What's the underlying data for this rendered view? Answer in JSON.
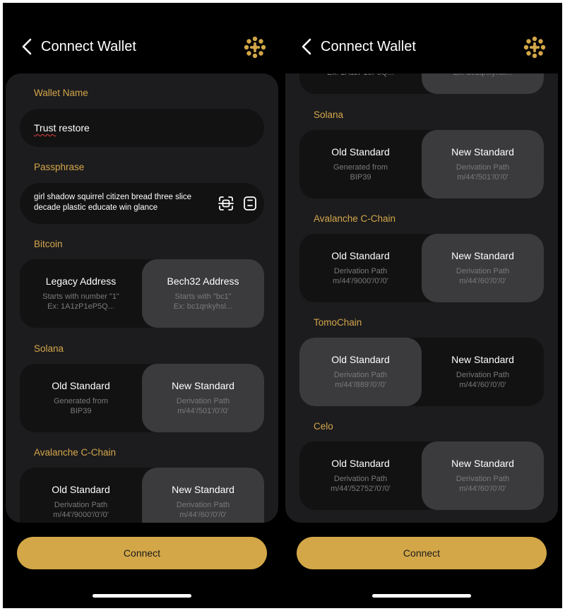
{
  "header": {
    "title": "Connect Wallet"
  },
  "wallet_name": {
    "label": "Wallet Name",
    "value": "Trust restore",
    "value_flagged": "Trust",
    "value_rest": " restore"
  },
  "passphrase": {
    "label": "Passphrase",
    "value": "girl shadow squirrel citizen bread three slice decade plastic educate win glance"
  },
  "bitcoin": {
    "label": "Bitcoin",
    "options": [
      {
        "title": "Legacy Address",
        "desc": "Starts with number \"1\"\nEx: 1A1zP1eP5Q..."
      },
      {
        "title": "Bech32 Address",
        "desc": "Starts with \"bc1\"\nEx: bc1qnkyhsl..."
      }
    ],
    "selected": 1
  },
  "solana": {
    "label": "Solana",
    "options": [
      {
        "title": "Old Standard",
        "desc": "Generated from\nBIP39"
      },
      {
        "title": "New Standard",
        "desc": "Derivation Path\nm/44'/501'/0'/0'"
      }
    ],
    "selected": 1
  },
  "avalanche": {
    "label": "Avalanche C-Chain",
    "options": [
      {
        "title": "Old Standard",
        "desc": "Derivation Path\nm/44'/9000'/0'/0'"
      },
      {
        "title": "New Standard",
        "desc": "Derivation Path\nm/44'/60'/0'/0'"
      }
    ],
    "selected": 1
  },
  "tomochain": {
    "label": "TomoChain",
    "options": [
      {
        "title": "Old Standard",
        "desc": "Derivation Path\nm/44'/889'/0'/0'"
      },
      {
        "title": "New Standard",
        "desc": "Derivation Path\nm/44'/60'/0'/0'"
      }
    ],
    "selected": 0
  },
  "celo": {
    "label": "Celo",
    "options": [
      {
        "title": "Old Standard",
        "desc": "Derivation Path\nm/44'/52752'/0'/0'"
      },
      {
        "title": "New Standard",
        "desc": "Derivation Path\nm/44'/60'/0'/0'"
      }
    ],
    "selected": 1
  },
  "connect_label": "Connect",
  "colors": {
    "accent": "#d3a748",
    "label": "#d4a64a",
    "panel": "#1c1c1e",
    "selected_option": "#3b3b3d"
  },
  "icons": {
    "back": "chevron-left-icon",
    "logo": "dots-logo-icon",
    "scan": "scan-icon",
    "paste": "clipboard-icon"
  }
}
